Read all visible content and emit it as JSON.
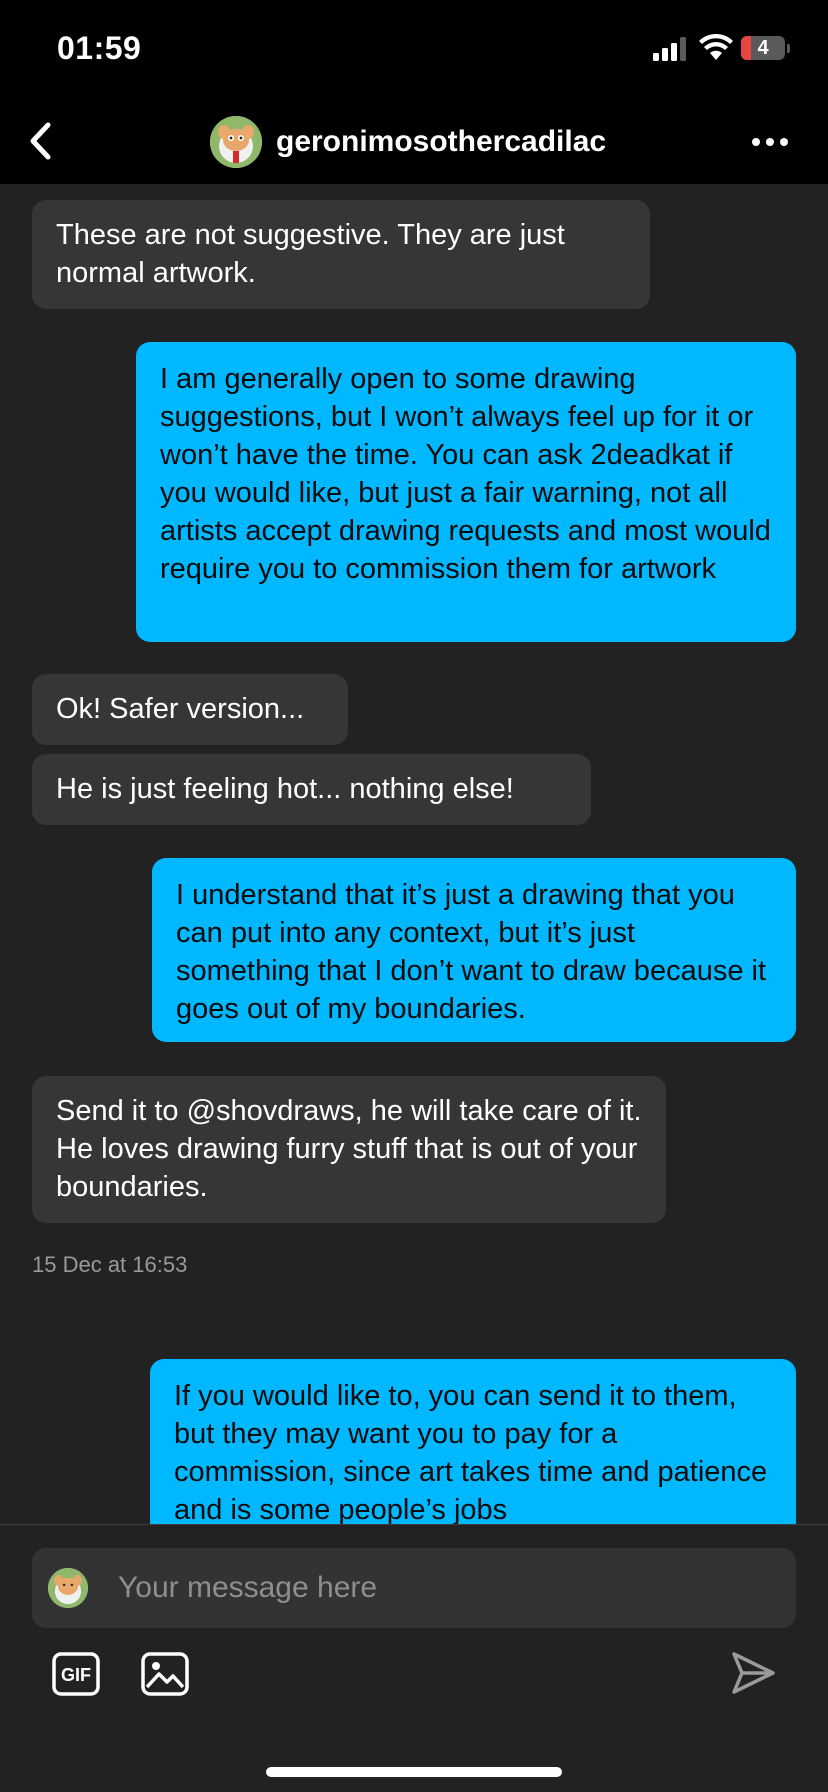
{
  "status_bar": {
    "time": "01:59",
    "battery_level": "4"
  },
  "header": {
    "username": "geronimosothercadilac"
  },
  "messages": [
    {
      "direction": "incoming",
      "text": "These are not suggestive. They are just normal artwork."
    },
    {
      "direction": "outgoing",
      "text": "I am generally open to some drawing suggestions, but I won’t always feel up for it or won’t have the time. You can ask 2deadkat if you would like, but just a fair warning, not all artists accept drawing requests and most would require you to commission them for artwork"
    },
    {
      "direction": "incoming",
      "text": "Ok! Safer version..."
    },
    {
      "direction": "incoming",
      "text": "He is just feeling hot... nothing else!"
    },
    {
      "direction": "outgoing",
      "text": "I understand that it’s just a drawing that you can put into any context, but it’s just something that I don’t want to draw because it goes out of my boundaries."
    },
    {
      "direction": "incoming",
      "text": "Send it to @shovdraws, he will take care of it. He loves drawing furry stuff that is out of your boundaries."
    },
    {
      "direction": "outgoing",
      "text": "If you would like to, you can send it to them, but they may want you to pay for a commission, since art takes time and patience and is some people’s jobs"
    }
  ],
  "timestamp": "15 Dec at 16:53",
  "composer": {
    "placeholder": "Your message here",
    "gif_label": "GIF"
  },
  "icons": {
    "back": "chevron-left-icon",
    "more": "ellipsis-icon",
    "gif": "gif-icon",
    "image": "image-icon",
    "send": "send-icon"
  },
  "colors": {
    "outgoing_bubble": "#00b8ff",
    "incoming_bubble": "#363636",
    "background": "#222222",
    "header": "#000000"
  }
}
